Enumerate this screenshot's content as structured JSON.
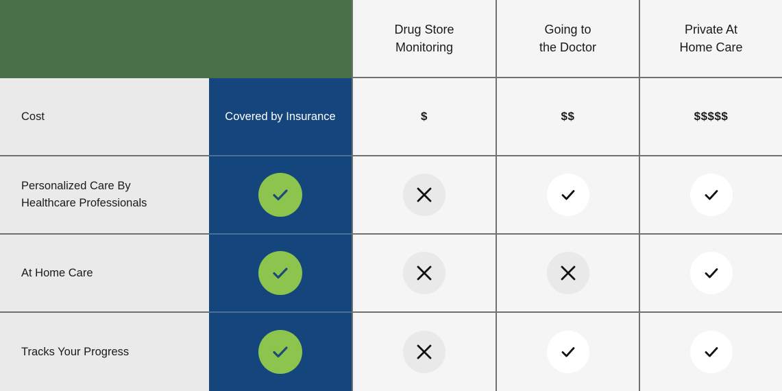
{
  "table": {
    "label_column_header": "",
    "highlight_column_header": "",
    "columns": [
      {
        "name": "drug-store-monitoring",
        "line1": "Drug Store",
        "line2": "Monitoring"
      },
      {
        "name": "going-to-the-doctor",
        "line1": "Going to",
        "line2": "the Doctor"
      },
      {
        "name": "private-at-home-care",
        "line1": "Private At",
        "line2": "Home Care"
      }
    ],
    "rows": [
      {
        "name": "cost",
        "label": "Cost",
        "highlight": {
          "type": "text",
          "value": "Covered by Insurance"
        },
        "cells": [
          {
            "type": "text",
            "value": "$"
          },
          {
            "type": "text",
            "value": "$$"
          },
          {
            "type": "text",
            "value": "$$$$$"
          }
        ]
      },
      {
        "name": "personalized-care-by-healthcare-professionals",
        "label": "Personalized Care By Healthcare Professionals",
        "label_line1": "Personalized Care By",
        "label_line2": "Healthcare Professionals",
        "highlight": {
          "type": "check-green",
          "value": "check"
        },
        "cells": [
          {
            "type": "cross",
            "value": "cross"
          },
          {
            "type": "check",
            "value": "check"
          },
          {
            "type": "check",
            "value": "check"
          }
        ]
      },
      {
        "name": "at-home-care",
        "label": "At Home Care",
        "highlight": {
          "type": "check-green",
          "value": "check"
        },
        "cells": [
          {
            "type": "cross",
            "value": "cross"
          },
          {
            "type": "cross",
            "value": "cross"
          },
          {
            "type": "check",
            "value": "check"
          }
        ]
      },
      {
        "name": "tracks-your-progress",
        "label": "Tracks Your Progress",
        "highlight": {
          "type": "check-green",
          "value": "check"
        },
        "cells": [
          {
            "type": "cross",
            "value": "cross"
          },
          {
            "type": "check",
            "value": "check"
          },
          {
            "type": "check",
            "value": "check"
          }
        ]
      }
    ]
  },
  "colors": {
    "header_green": "#4a7049",
    "highlight_blue": "#14467d",
    "check_green": "#8cc44e",
    "label_bg": "#eaeaea",
    "cell_bg": "#f5f5f5",
    "border": "#707070"
  }
}
